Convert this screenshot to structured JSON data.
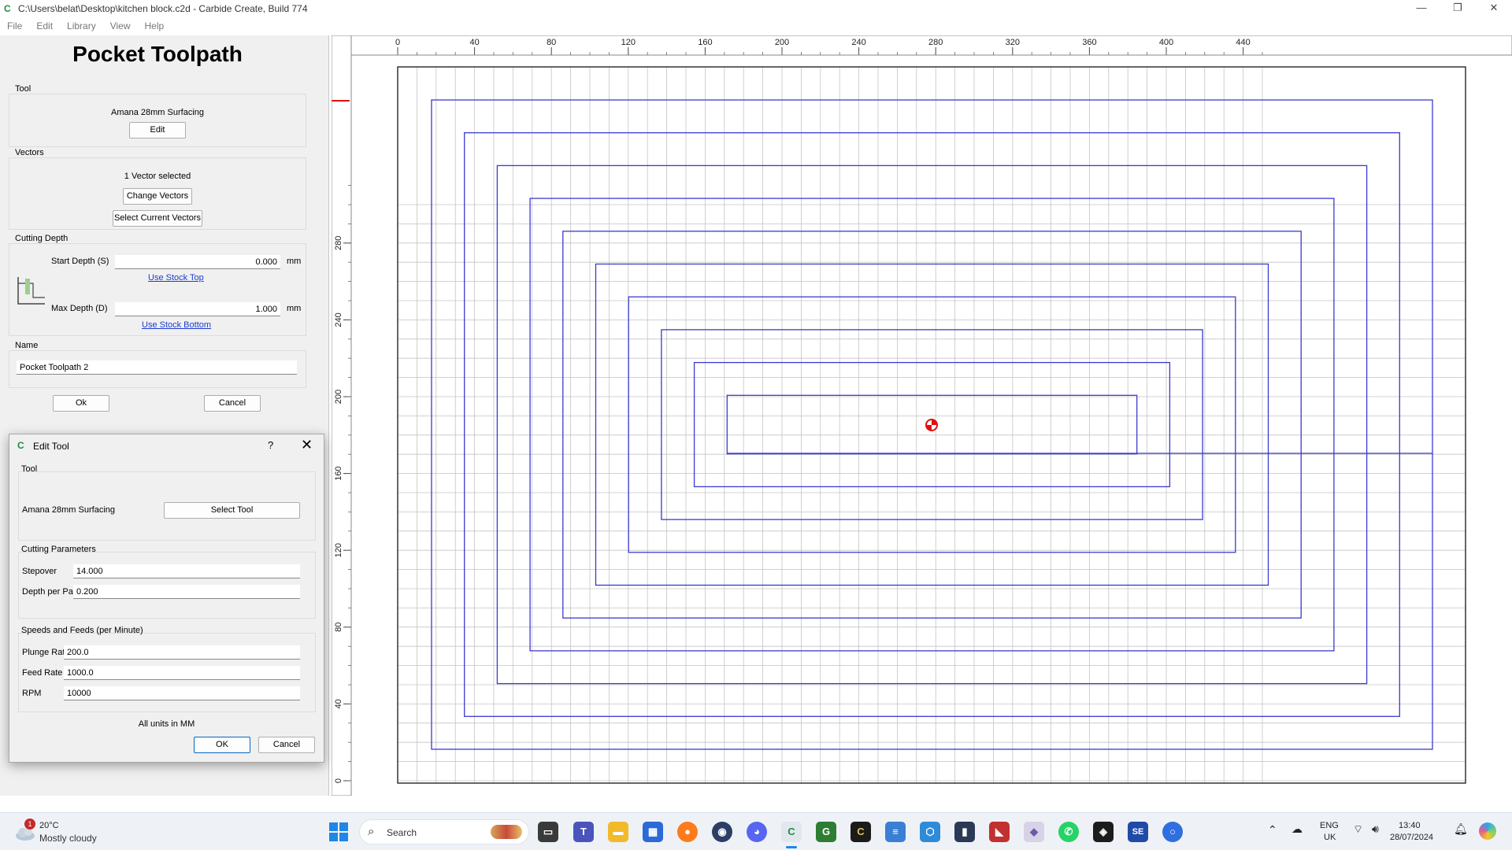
{
  "window": {
    "title": "C:\\Users\\belat\\Desktop\\kitchen block.c2d - Carbide Create, Build 774",
    "minimize": "—",
    "maximize": "❐",
    "close": "✕"
  },
  "menu": [
    "File",
    "Edit",
    "Library",
    "View",
    "Help"
  ],
  "panel": {
    "title": "Pocket Toolpath",
    "tool_group": "Tool",
    "tool_name": "Amana 28mm Surfacing",
    "edit_button": "Edit",
    "vectors_group": "Vectors",
    "vectors_selected": "1 Vector selected",
    "change_vectors": "Change Vectors",
    "select_current_vectors": "Select Current Vectors",
    "depth_group": "Cutting Depth",
    "start_depth_label": "Start Depth (S)",
    "start_depth_value": "0.000",
    "start_unit": "mm",
    "use_stock_top": "Use Stock Top",
    "max_depth_label": "Max Depth (D)",
    "max_depth_value": "1.000",
    "max_unit": "mm",
    "use_stock_bottom": "Use Stock Bottom",
    "name_group": "Name",
    "name_value": "Pocket Toolpath 2",
    "ok": "Ok",
    "cancel": "Cancel"
  },
  "dialog": {
    "title": "Edit Tool",
    "help": "?",
    "close": "✕",
    "tool_group": "Tool",
    "tool_name": "Amana 28mm Surfacing",
    "select_tool": "Select Tool",
    "cutting_group": "Cutting Parameters",
    "stepover_label": "Stepover",
    "stepover_value": "14.000",
    "dpp_label": "Depth per Pass",
    "dpp_value": "0.200",
    "speeds_group": "Speeds and Feeds (per Minute)",
    "plunge_label": "Plunge Rate",
    "plunge_value": "200.0",
    "feed_label": "Feed Rate",
    "feed_value": "1000.0",
    "rpm_label": "RPM",
    "rpm_value": "10000",
    "units_note": "All units in MM",
    "ok": "OK",
    "cancel": "Cancel"
  },
  "canvas": {
    "x_ticks": [
      "0",
      "40",
      "80",
      "120",
      "160",
      "200",
      "240",
      "280",
      "320",
      "360",
      "400",
      "440"
    ],
    "y_ticks": [
      "280",
      "240",
      "200",
      "160",
      "120",
      "80",
      "40",
      "0"
    ],
    "toolpath_color": "#3a3acf",
    "grid_color": "#c4c4c4",
    "origin_marker_color": "#e01010"
  },
  "taskbar": {
    "weather_temp": "20°C",
    "weather_desc": "Mostly cloudy",
    "weather_badge": "1",
    "search": "Search",
    "lang_top": "ENG",
    "lang_bottom": "UK",
    "time": "13:40",
    "date": "28/07/2024"
  }
}
